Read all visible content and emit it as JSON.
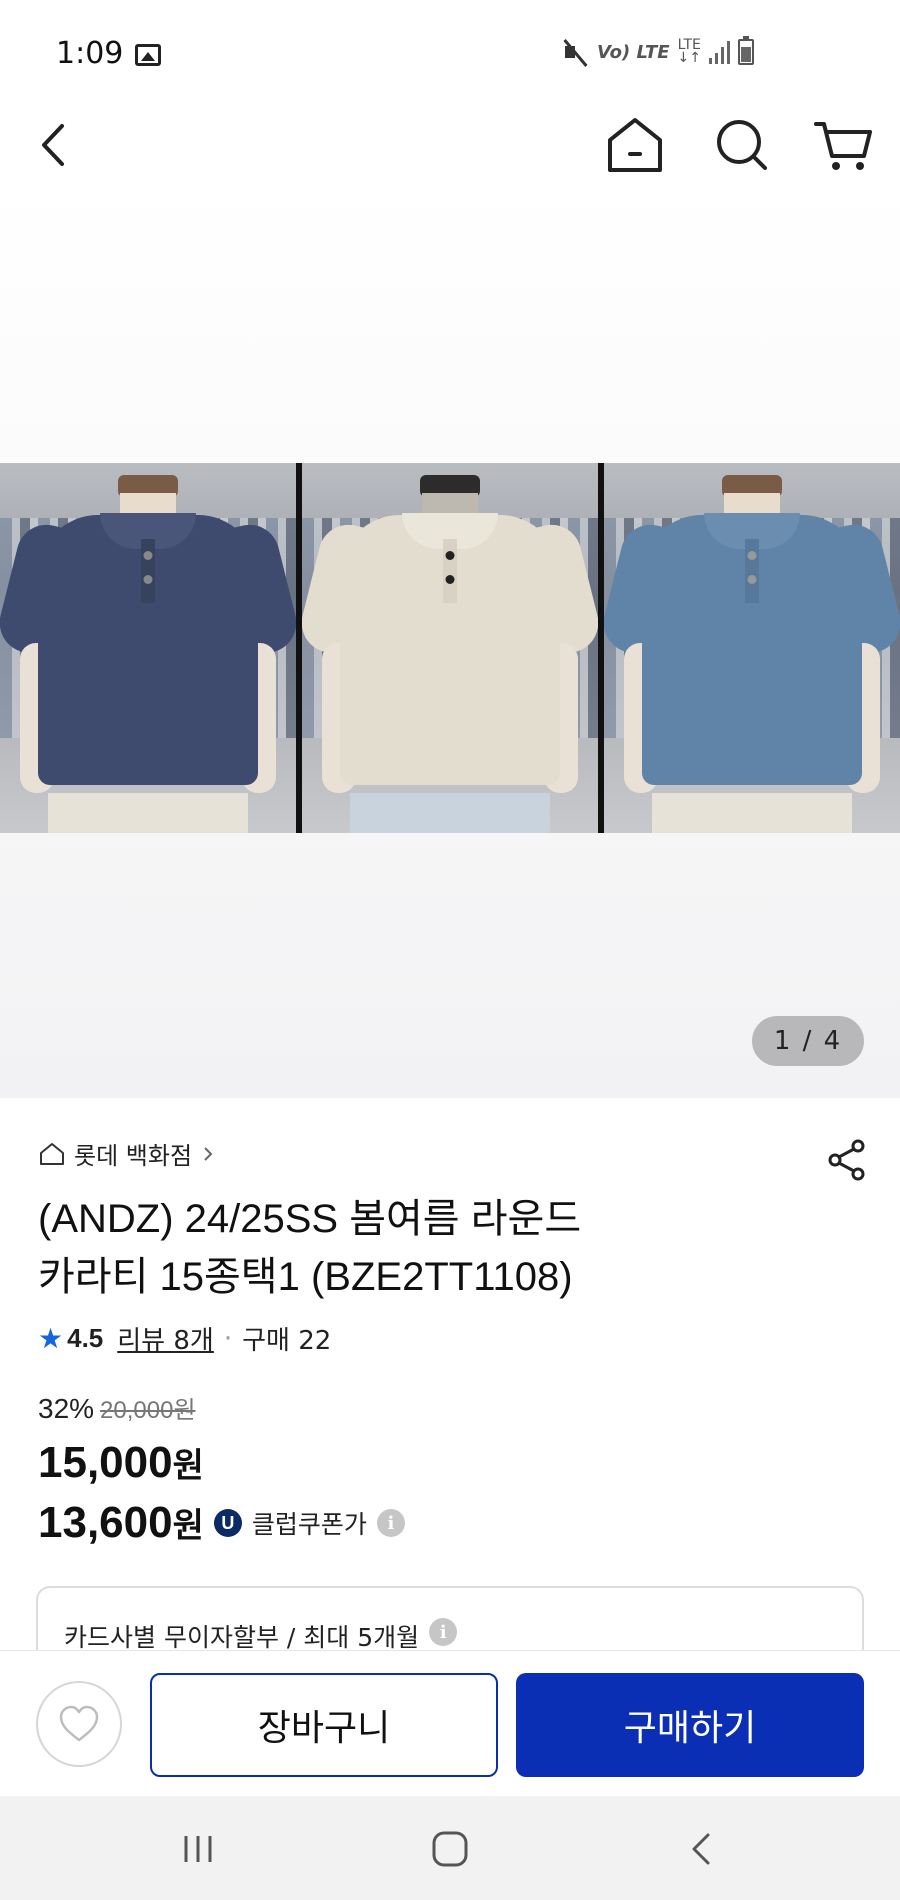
{
  "status_bar": {
    "time": "1:09",
    "volte": "Vo) LTE",
    "lte": "LTE"
  },
  "top_nav": {
    "icons": [
      "chevron-left-icon",
      "home-icon",
      "search-icon",
      "cart-icon"
    ]
  },
  "gallery": {
    "pager": "1 / 4",
    "shirts": [
      {
        "name": "navy",
        "color": "#3f4b6e"
      },
      {
        "name": "cream",
        "color": "#e3ddd0"
      },
      {
        "name": "blue",
        "color": "#5f84a8"
      }
    ]
  },
  "product": {
    "store_name": "롯데 백화점",
    "title_line1": "(ANDZ) 24/25SS 봄여름 라운드",
    "title_line2": "카라티 15종택1 (BZE2TT1108)",
    "rating": "4.5",
    "review_label": "리뷰 8개",
    "purchase_label": "구매 22",
    "discount_rate": "32%",
    "original_price": "20,000원",
    "sale_price_number": "15,000",
    "sale_price_unit": "원",
    "coupon_price_number": "13,600",
    "coupon_price_unit": "원",
    "coupon_badge": "U",
    "coupon_label": "클럽쿠폰가",
    "installment": "카드사별 무이자할부 / 최대 5개월"
  },
  "actions": {
    "cart_label": "장바구니",
    "buy_label": "구매하기"
  },
  "colors": {
    "primary": "#0a2fb4",
    "star": "#1565e0",
    "coupon_badge_bg": "#0b2a66"
  }
}
